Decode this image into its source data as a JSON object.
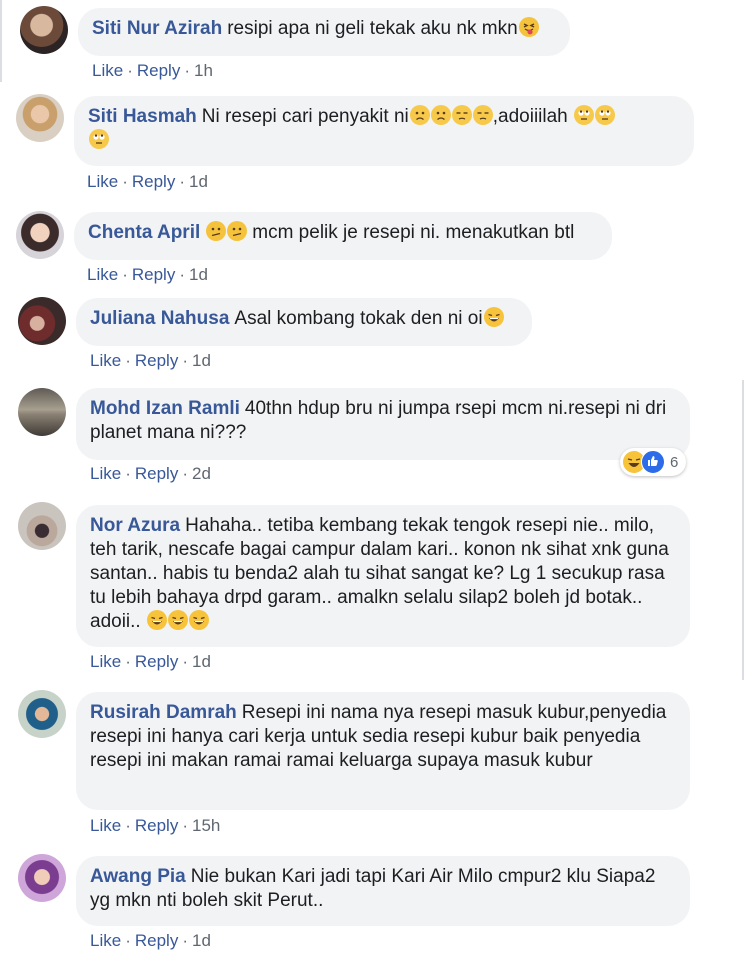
{
  "comments": [
    {
      "name": "Siti Nur Azirah",
      "text": "resipi apa ni geli tekak aku nk mkn",
      "emojis": [
        "squinting-tongue-emoji"
      ],
      "like": "Like",
      "reply": "Reply",
      "time": "1h"
    },
    {
      "name": "Siti Hasmah",
      "text_a": "Ni resepi cari penyakit ni",
      "text_b": ",adoiiilah",
      "emojis_a": [
        "frowning-emoji",
        "frowning-emoji",
        "unamused-emoji",
        "unamused-emoji"
      ],
      "emojis_b": [
        "eye-roll-emoji",
        "eye-roll-emoji",
        "eye-roll-emoji"
      ],
      "like": "Like",
      "reply": "Reply",
      "time": "1d"
    },
    {
      "name": "Chenta April",
      "text": "mcm pelik je resepi ni. menakutkan btl",
      "emojis": [
        "confused-emoji",
        "confused-emoji"
      ],
      "like": "Like",
      "reply": "Reply",
      "time": "1d"
    },
    {
      "name": "Juliana Nahusa",
      "text": "Asal kombang tokak den ni oi",
      "emojis": [
        "laughing-emoji"
      ],
      "like": "Like",
      "reply": "Reply",
      "time": "1d"
    },
    {
      "name": "Mohd Izan Ramli",
      "text": "40thn hdup bru ni jumpa rsepi mcm ni.resepi ni dri planet mana ni???",
      "like": "Like",
      "reply": "Reply",
      "time": "2d",
      "reaction_count": "6",
      "reaction_icons": [
        "laugh-reaction-icon",
        "like-reaction-icon"
      ]
    },
    {
      "name": "Nor Azura",
      "text": "Hahaha.. tetiba kembang tekak tengok resepi nie.. milo, teh tarik, nescafe bagai campur dalam kari.. konon nk sihat xnk guna santan.. habis tu benda2 alah tu sihat sangat ke? Lg 1 secukup rasa tu lebih bahaya drpd garam.. amalkn selalu silap2 boleh jd botak.. adoii..",
      "emojis": [
        "laughing-emoji",
        "laughing-emoji",
        "laughing-emoji"
      ],
      "like": "Like",
      "reply": "Reply",
      "time": "1d"
    },
    {
      "name": "Rusirah Damrah",
      "text": "Resepi ini nama nya resepi masuk kubur,penyedia resepi ini hanya cari kerja untuk sedia resepi kubur baik penyedia resepi ini makan ramai ramai keluarga supaya masuk kubur",
      "like": "Like",
      "reply": "Reply",
      "time": "15h"
    },
    {
      "name": "Awang Pia",
      "text": "Nie bukan Kari jadi tapi Kari Air Milo cmpur2 klu Siapa2 yg mkn nti boleh skit Perut..",
      "like": "Like",
      "reply": "Reply",
      "time": "1d"
    }
  ],
  "separator": "·",
  "colors": {
    "name": "#385898",
    "bubble": "#f2f3f5",
    "meta": "#606770"
  }
}
